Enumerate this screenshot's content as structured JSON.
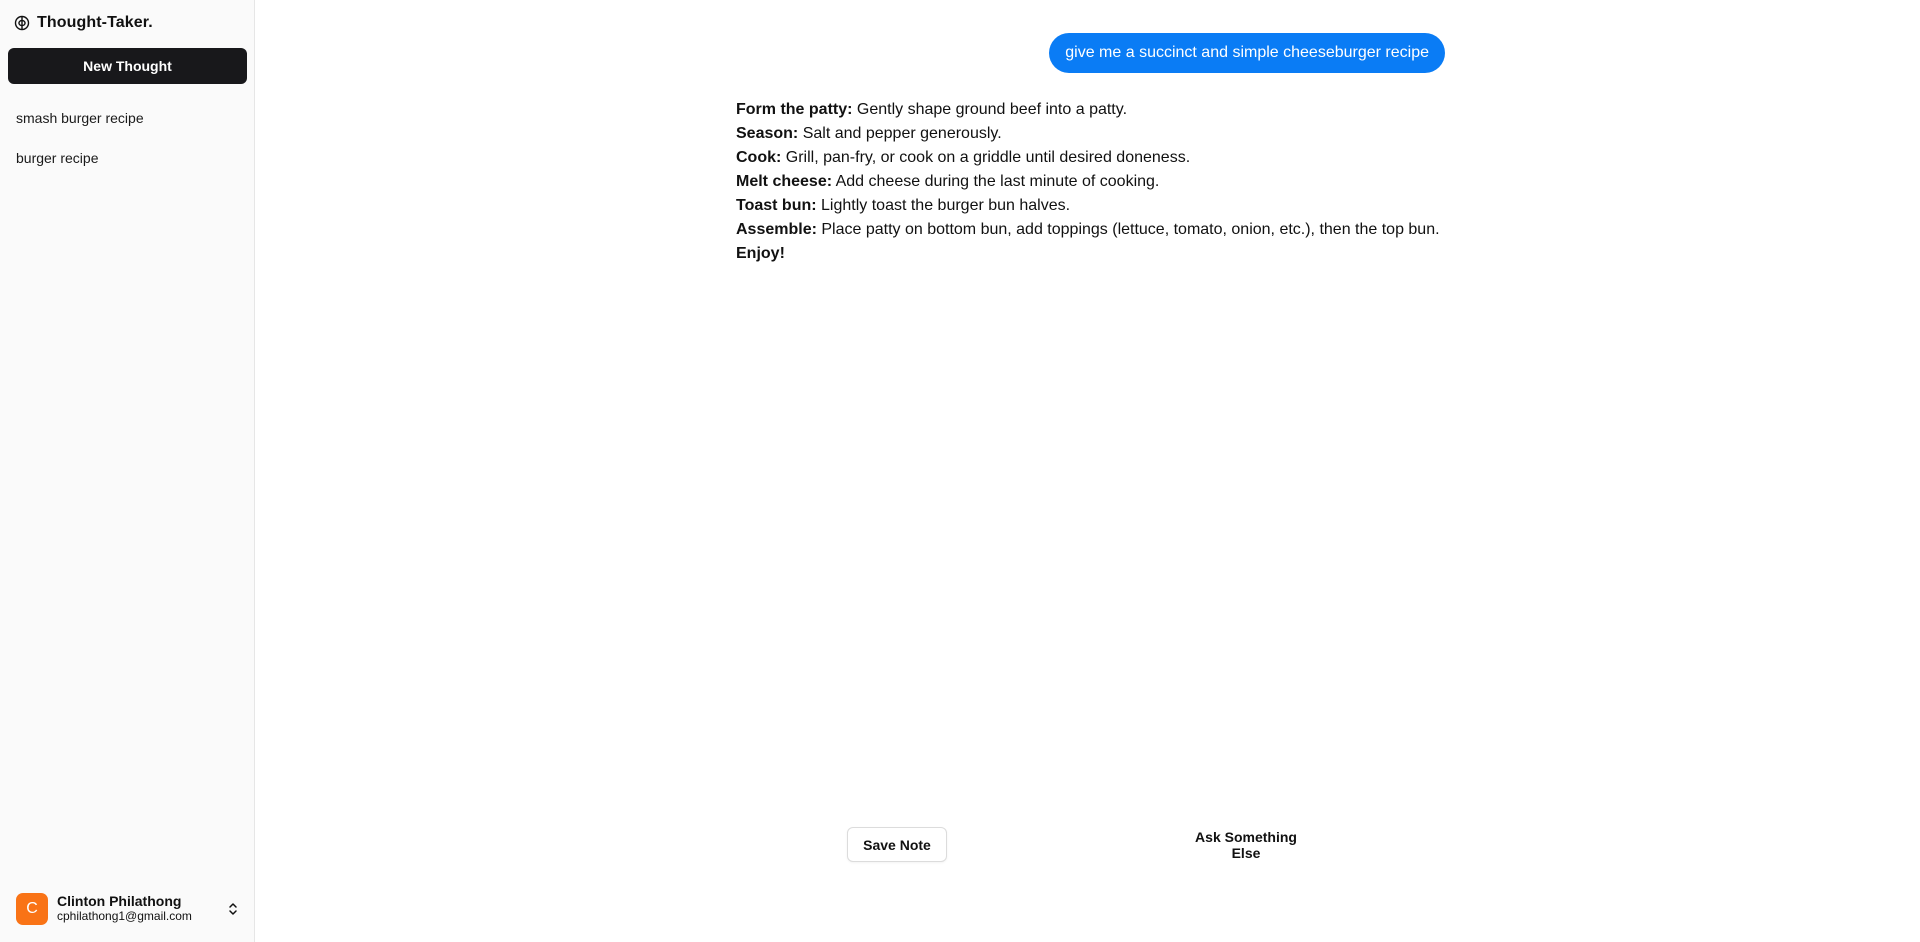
{
  "app": {
    "brand_icon": "brain-icon",
    "title": "Thought-Taker."
  },
  "sidebar": {
    "new_thought_label": "New Thought",
    "history": [
      {
        "label": "smash burger recipe"
      },
      {
        "label": "burger recipe"
      }
    ],
    "user": {
      "avatar_initial": "C",
      "avatar_color": "#f97316",
      "name": "Clinton Philathong",
      "email": "cphilathong1@gmail.com",
      "toggle_icon": "chevrons-up-down-icon"
    }
  },
  "chat": {
    "user_message": "give me a succinct and simple cheeseburger recipe",
    "bubble_color": "#0a7cf5",
    "response": [
      {
        "label": "Form the patty:",
        "text": " Gently shape ground beef into a patty."
      },
      {
        "label": "Season:",
        "text": " Salt and pepper generously."
      },
      {
        "label": "Cook:",
        "text": " Grill, pan-fry, or cook on a griddle until desired doneness."
      },
      {
        "label": "Melt cheese:",
        "text": " Add cheese during the last minute of cooking."
      },
      {
        "label": "Toast bun:",
        "text": " Lightly toast the burger bun halves."
      },
      {
        "label": "Assemble:",
        "text": " Place patty on bottom bun, add toppings (lettuce, tomato, onion, etc.), then the top bun."
      },
      {
        "label": "Enjoy!",
        "text": ""
      }
    ]
  },
  "actions": {
    "save_label": "Save Note",
    "ask_label": "Ask Something Else"
  }
}
